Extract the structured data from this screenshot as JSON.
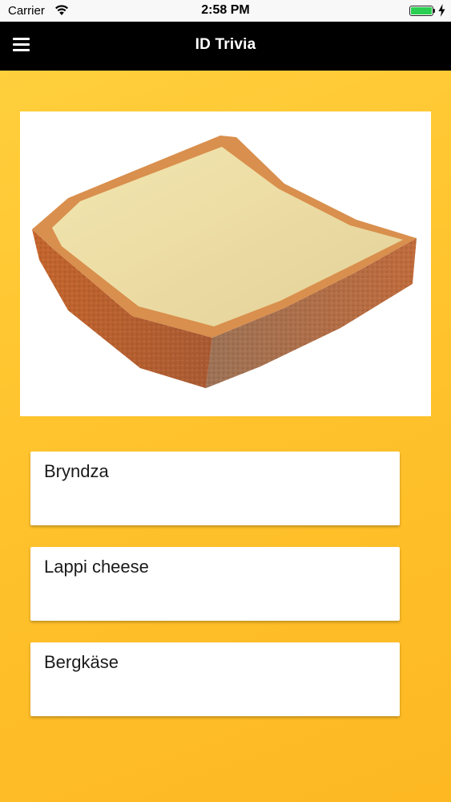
{
  "status_bar": {
    "carrier": "Carrier",
    "time": "2:58 PM",
    "wifi_icon": "wifi-icon",
    "battery_icon": "battery-icon",
    "battery_color": "#2bd052"
  },
  "app_bar": {
    "title": "ID Trivia",
    "menu_icon": "hamburger-menu-icon",
    "background": "#000000"
  },
  "question": {
    "image": "cheese-wedge-photo"
  },
  "answers": [
    {
      "label": "Bryndza"
    },
    {
      "label": "Lappi cheese"
    },
    {
      "label": "Bergkäse"
    }
  ],
  "colors": {
    "background_top": "#ffd13f",
    "background_bottom": "#fdb822",
    "answer_card": "#ffffff"
  }
}
